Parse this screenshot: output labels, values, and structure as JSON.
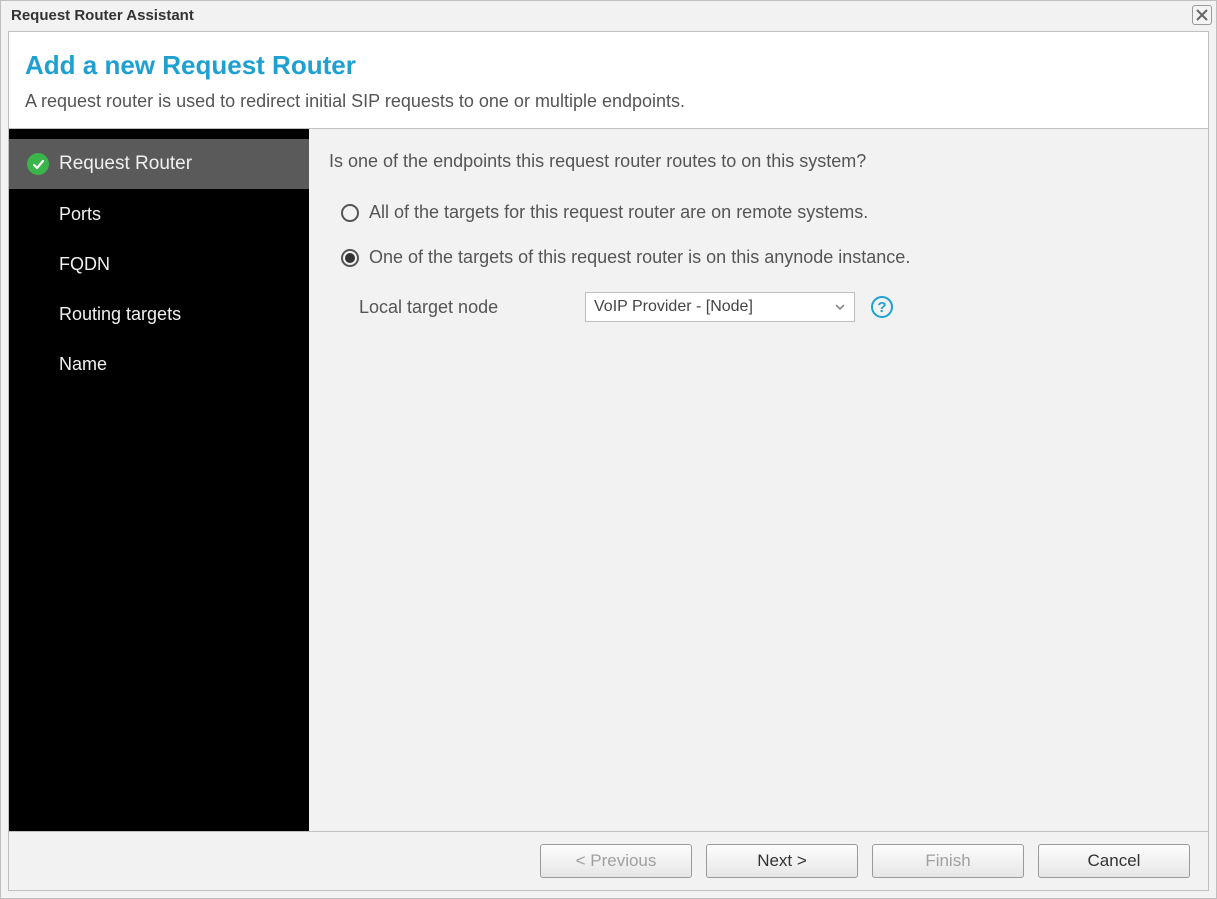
{
  "window": {
    "title": "Request Router Assistant"
  },
  "header": {
    "title": "Add a new Request Router",
    "description": "A request router is used to redirect initial SIP requests to one or multiple endpoints."
  },
  "sidebar": {
    "items": [
      {
        "label": "Request Router",
        "active": true,
        "completed": true
      },
      {
        "label": "Ports"
      },
      {
        "label": "FQDN"
      },
      {
        "label": "Routing targets"
      },
      {
        "label": "Name"
      }
    ]
  },
  "content": {
    "question": "Is one of the endpoints this request router routes to on this system?",
    "options": [
      {
        "label": "All of the targets for this request router are on remote systems.",
        "checked": false
      },
      {
        "label": "One of the targets of this request router is on this anynode instance.",
        "checked": true
      }
    ],
    "local_target": {
      "label": "Local target node",
      "selected": "VoIP Provider - [Node]"
    }
  },
  "footer": {
    "previous": "< Previous",
    "next": "Next >",
    "finish": "Finish",
    "cancel": "Cancel"
  }
}
